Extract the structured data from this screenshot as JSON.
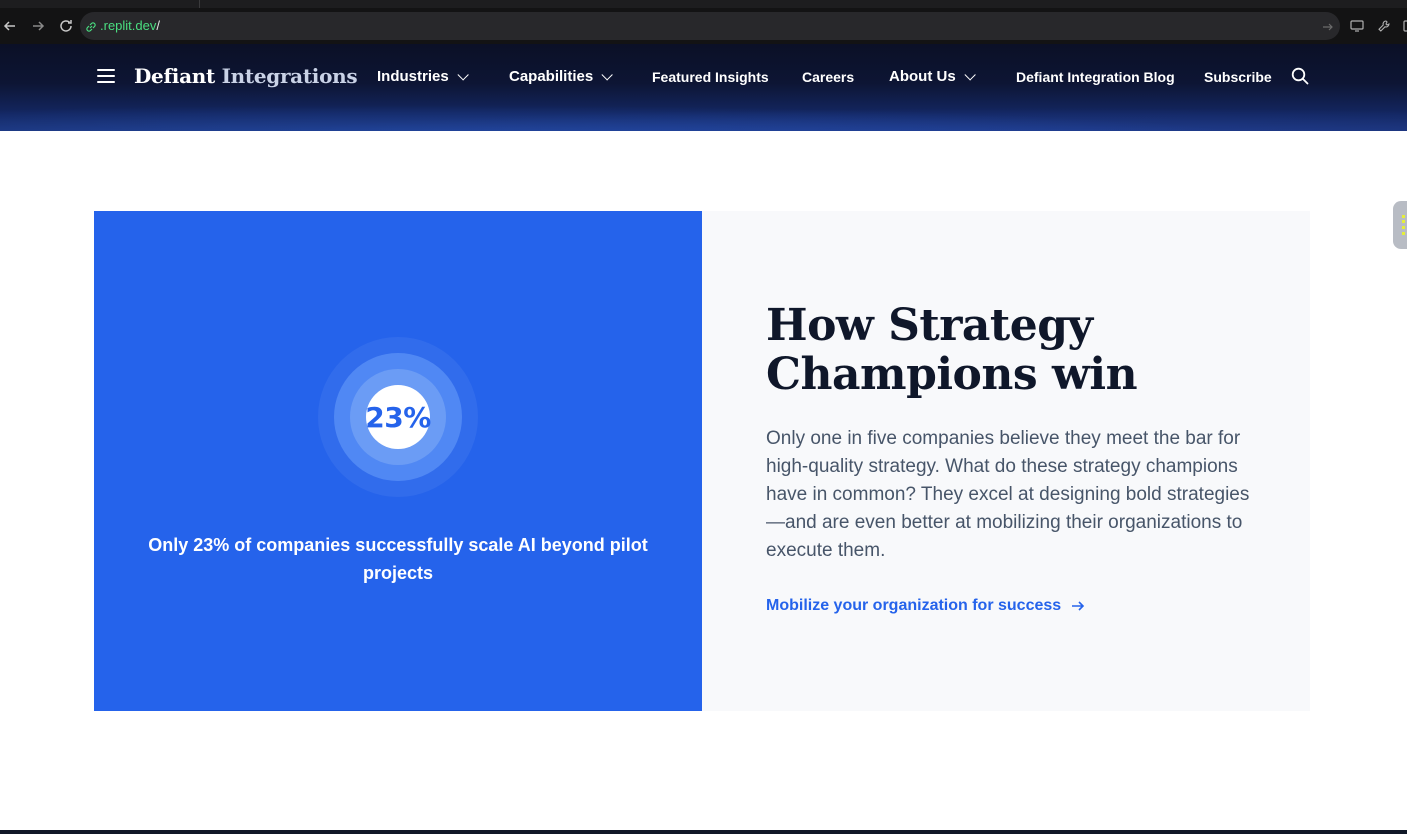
{
  "browser": {
    "url_host": ".replit.dev",
    "url_path": "/"
  },
  "header": {
    "brand_primary": "Defiant",
    "brand_accent": "Integrations",
    "nav": {
      "industries": "Industries",
      "capabilities": "Capabilities",
      "featured_insights": "Featured Insights",
      "careers": "Careers",
      "about_us": "About Us",
      "blog": "Defiant Integration Blog",
      "subscribe": "Subscribe"
    }
  },
  "stat": {
    "value_label": "23%",
    "caption": "Only 23% of companies successfully scale AI beyond pilot projects"
  },
  "info": {
    "headline": "How Strategy Champions win",
    "body": "Only one in five companies believe they meet the bar for high-quality strategy. What do these strategy champions have in common? They excel at designing bold strategies—and are even better at mobilizing their organizations to execute them.",
    "cta": "Mobilize your organization for success"
  },
  "colors": {
    "accent_blue": "#2563eb",
    "header_navy": "#0d1534",
    "headline_text": "#0f172a",
    "url_green": "#4ade80"
  },
  "icons": [
    "back-arrow-icon",
    "forward-arrow-icon",
    "reload-icon",
    "link-icon",
    "send-icon",
    "monitor-icon",
    "wrench-icon",
    "hamburger-menu-icon",
    "chevron-down-icon",
    "search-icon",
    "arrow-right-icon"
  ]
}
